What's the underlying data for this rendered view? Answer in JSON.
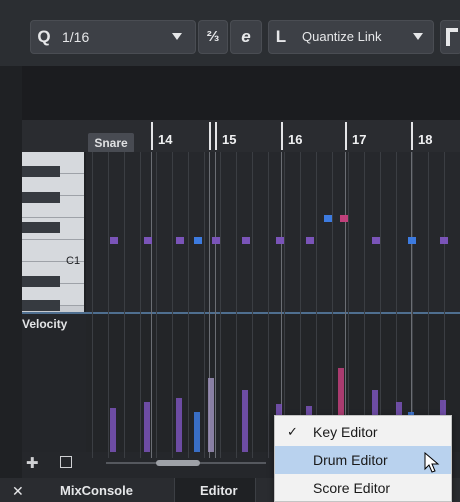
{
  "toolbar": {
    "quantize_value": "1/16",
    "length_mode_label": "Quantize Link"
  },
  "ruler": {
    "bars": [
      "14",
      "15",
      "16",
      "17",
      "18"
    ],
    "lane_label": "Snare"
  },
  "piano": {
    "c1_label": "C1"
  },
  "velocity": {
    "label": "Velocity"
  },
  "bottom_tabs": [
    {
      "label": "MixConsole"
    },
    {
      "label": "Editor"
    }
  ],
  "context_menu": {
    "items": [
      {
        "label": "Key Editor",
        "checked": true
      },
      {
        "label": "Drum Editor",
        "checked": false,
        "highlighted": true
      },
      {
        "label": "Score Editor",
        "checked": false
      }
    ]
  },
  "colors": {
    "note_purple": "#7a54b8",
    "note_blue": "#3d7be0",
    "note_pink": "#c1407b",
    "menu_highlight": "#b9d2ee"
  }
}
